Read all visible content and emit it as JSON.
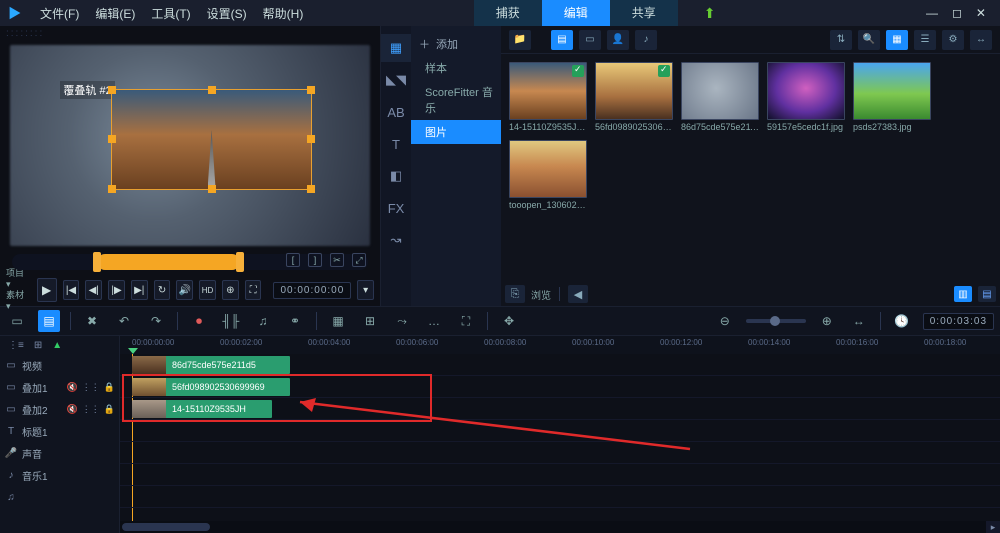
{
  "menu": {
    "file": "文件(F)",
    "edit": "编辑(E)",
    "tool": "工具(T)",
    "settings": "设置(S)",
    "help": "帮助(H)"
  },
  "tabs": {
    "capture": "捕获",
    "edit": "编辑",
    "share": "共享"
  },
  "preview": {
    "overlay_label": "覆叠轨 #2",
    "timecode": "00:00:00:00",
    "project": "项目 ▾",
    "material": "素材 ▾"
  },
  "library": {
    "add": "添加",
    "sample": "样本",
    "score": "ScoreFitter 音乐",
    "images": "图片",
    "thumbs": [
      {
        "name": "14-15110Z9535JH.jpg",
        "checked": true,
        "cls": "t1"
      },
      {
        "name": "56fd098902530699660...",
        "checked": true,
        "cls": "t2"
      },
      {
        "name": "86d75cde575e211d5...",
        "checked": false,
        "cls": "t3"
      },
      {
        "name": "59157e5cedc1f.jpg",
        "checked": false,
        "cls": "t4"
      },
      {
        "name": "psds27383.jpg",
        "checked": false,
        "cls": "t5"
      },
      {
        "name": "tooopen_13060231.jpg",
        "checked": false,
        "cls": "t6"
      }
    ],
    "browse": "浏览"
  },
  "timeline": {
    "timecode": "0:00:03:03",
    "ticks": [
      "00:00:00:00",
      "00:00:02:00",
      "00:00:04:00",
      "00:00:06:00",
      "00:00:08:00",
      "00:00:10:00",
      "00:00:12:00",
      "00:00:14:00",
      "00:00:16:00",
      "00:00:18:00"
    ],
    "tracks": {
      "video": "视频",
      "ov1": "叠加1",
      "ov2": "叠加2",
      "title": "标题1",
      "voice": "声音",
      "music": "音乐1"
    },
    "clips": {
      "c1": "86d75cde575e211d5",
      "c2": "56fd098902530699969",
      "c3": "14-15110Z9535JH"
    }
  }
}
